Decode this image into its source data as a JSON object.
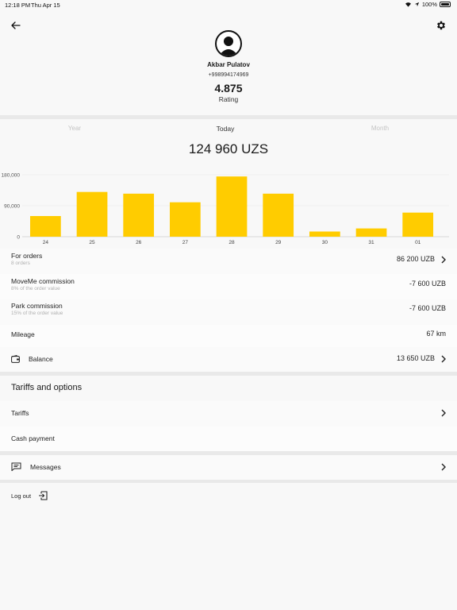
{
  "status_bar": {
    "time": "12:18 PM",
    "date": "Thu Apr 15",
    "battery": "100%"
  },
  "profile": {
    "name": "Akbar Pulatov",
    "phone": "+998994174969",
    "rating": "4.875",
    "rating_label": "Rating"
  },
  "periods": [
    {
      "label": "Year",
      "active": false
    },
    {
      "label": "Today",
      "active": true
    },
    {
      "label": "Month",
      "active": false
    }
  ],
  "total": "124 960 UZS",
  "chart_data": {
    "type": "bar",
    "categories": [
      "24",
      "25",
      "26",
      "27",
      "28",
      "29",
      "30",
      "31",
      "01"
    ],
    "values": [
      60000,
      130000,
      125000,
      100000,
      175000,
      125000,
      15000,
      24000,
      70000
    ],
    "ylim": [
      0,
      180000
    ],
    "yticks": [
      "0",
      "90,000",
      "180,000"
    ],
    "bar_color": "#ffcc00",
    "grid": true
  },
  "stats": {
    "orders_label": "For orders",
    "orders_sub": "8 orders",
    "orders_value": "86 200 UZB",
    "moveme_label": "MoveMe commission",
    "moveme_sub": "8% of the order value",
    "moveme_value": "-7 600 UZB",
    "park_label": "Park commission",
    "park_sub": "15% of the order value",
    "park_value": "-7 600 UZB",
    "mileage_label": "Mileage",
    "mileage_value": "67 km",
    "balance_label": "Balance",
    "balance_value": "13 650 UZB"
  },
  "tariffs": {
    "title": "Tariffs and options",
    "tariffs_label": "Tariffs",
    "cash_label": "Cash payment"
  },
  "messages_label": "Messages",
  "logout_label": "Log out",
  "icons": [
    "back-arrow-icon",
    "gear-icon",
    "avatar-person-icon",
    "wallet-icon",
    "message-icon",
    "logout-icon",
    "chevron-right-icon"
  ],
  "colors": {
    "accent": "#ffcc00",
    "background": "#f8f8f8",
    "divider": "#e9e9e9"
  }
}
